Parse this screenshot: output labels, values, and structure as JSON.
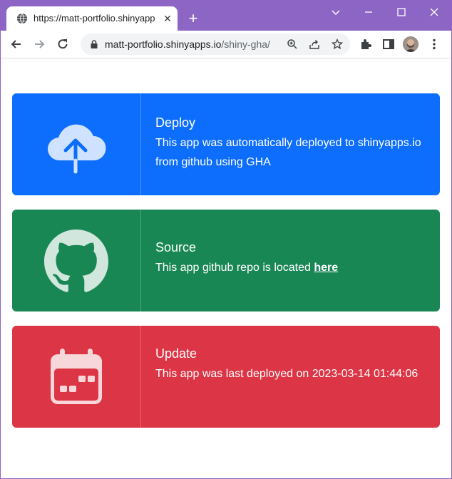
{
  "browser": {
    "tab_title": "https://matt-portfolio.shinyapps.i",
    "url_host": "matt-portfolio.shinyapps.io",
    "url_path": "/shiny-gha/"
  },
  "cards": [
    {
      "title": "Deploy",
      "text": "This app was automatically deployed to shinyapps.io from github using GHA",
      "color": "#0d6efd",
      "icon": "cloud-upload-icon"
    },
    {
      "title": "Source",
      "text_prefix": "This app github repo is located",
      "link_text": "here",
      "color": "#198754",
      "icon": "github-icon"
    },
    {
      "title": "Update",
      "text": "This app was last deployed on 2023-03-14 01:44:06",
      "color": "#dc3545",
      "icon": "calendar-icon"
    }
  ],
  "colors": {
    "titlebar": "#8d65c5",
    "icon_tint": "#cfe2ff"
  }
}
